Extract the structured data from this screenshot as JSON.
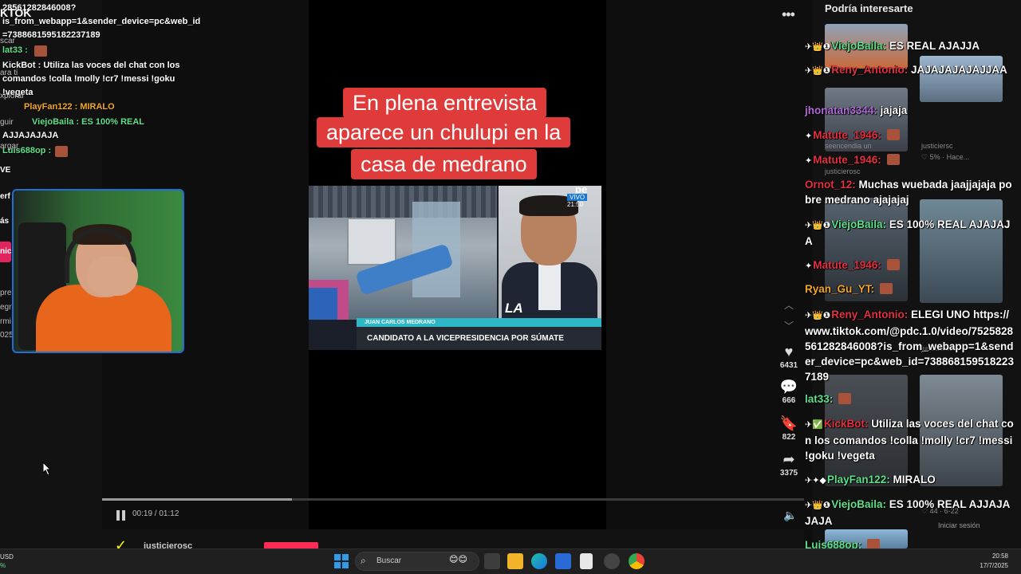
{
  "tiktok": {
    "caption_lines": [
      "En plena entrevista",
      "aparece un chulupi en la",
      "casa de medrano"
    ],
    "news": {
      "channel_logo": "pe",
      "live_label": "VIVO",
      "live_time": "21:50",
      "show_name": "LA CAFETERIA",
      "person_name": "JUAN CARLOS MEDRANO",
      "person_title": "CANDIDATO A LA VICEPRESIDENCIA POR SÚMATE"
    },
    "player": {
      "current_time": "00:19",
      "duration": "01:12",
      "time_display": "00:19 / 01:12",
      "progress_fraction": 0.27
    },
    "author": {
      "name": "justicierosc"
    },
    "actions": [
      {
        "name": "like",
        "icon": "heart-icon",
        "count": "6431"
      },
      {
        "name": "comment",
        "icon": "comment-icon",
        "count": "666"
      },
      {
        "name": "bookmark",
        "icon": "bookmark-icon",
        "count": "822"
      },
      {
        "name": "share",
        "icon": "share-icon",
        "count": "3375"
      }
    ],
    "suggest_title": "Podría interesarte",
    "suggest_meta": [
      "justiciersc",
      "♡ 5% · Hace...",
      "seencendia un",
      "justicierosc",
      "justicierosc",
      "♡ 44 · 6-22"
    ],
    "login_text": "Iniciar sesión"
  },
  "left_chat": {
    "lines": [
      "28561282846008?",
      "is_from_webapp=1&sender_device=pc&web_id",
      "=7388681595182237189",
      "lat33 :",
      "KickBot : Utiliza las voces del chat con los",
      "comandos !colla !molly !cr7 !messi !goku",
      "!vegeta",
      "PlayFan122 : MIRALO",
      "ViejoBaila : ES 100% REAL",
      "AJJAJAJAJA",
      "Luis688op :"
    ],
    "side_fragments": [
      "KTOK",
      "scar",
      "ara ti",
      "xplorar",
      "guir",
      "argar",
      "VE",
      "erf",
      "ás",
      "nic",
      "pre",
      "egr",
      "rmi",
      "025"
    ]
  },
  "right_chat": [
    {
      "user": "ViejoBaila",
      "color": "green",
      "badges": "✈👑❶",
      "text": "ES REAL AJAJJA"
    },
    {
      "user": "Reny_Antonio",
      "color": "red",
      "badges": "✈👑❶",
      "text": "JAJAJAJAJAJJAA"
    },
    {
      "user": "jhonatan3344",
      "color": "purple",
      "badges": "",
      "text": "jajaja"
    },
    {
      "user": "Matute_1946",
      "color": "red",
      "badges": "✦",
      "text": ""
    },
    {
      "user": "Matute_1946",
      "color": "red",
      "badges": "✦",
      "text": ""
    },
    {
      "user": "Ornot_12",
      "color": "red",
      "badges": "",
      "text": "Muchas wuebada jaajjajaja pobre medrano ajajajaj"
    },
    {
      "user": "ViejoBaila",
      "color": "green",
      "badges": "✈👑❶",
      "text": "ES 100% REAL AJAJAJA"
    },
    {
      "user": "Matute_1946",
      "color": "red",
      "badges": "✦",
      "text": ""
    },
    {
      "user": "Ryan_Gu_YT",
      "color": "orange",
      "badges": "",
      "text": ""
    },
    {
      "user": "Reny_Antonio",
      "color": "red",
      "badges": "✈👑❶",
      "text": "ELEGI UNO https://www.tiktok.com/@pdc.1.0/video/7525828561282846008?is_from_webapp=1&sender_device=pc&web_id=7388681595182237189"
    },
    {
      "user": "lat33",
      "color": "green",
      "badges": "",
      "text": ""
    },
    {
      "user": "KickBot",
      "color": "red",
      "badges": "✈✅",
      "text": "Utiliza las voces del chat con los comandos !colla !molly !cr7 !messi !goku !vegeta"
    },
    {
      "user": "PlayFan122",
      "color": "green",
      "badges": "✈✦◆",
      "text": "MIRALO"
    },
    {
      "user": "ViejoBaila",
      "color": "green",
      "badges": "✈👑❶",
      "text": "ES 100% REAL AJJAJAJAJA"
    },
    {
      "user": "Luis688op",
      "color": "green",
      "badges": "",
      "text": ""
    }
  ],
  "taskbar": {
    "weather_line1": "USD",
    "weather_line2": "%",
    "search_placeholder": "Buscar",
    "time": "20:58",
    "date": "17/7/2025"
  },
  "colors": {
    "caption_red": "#e03b3b",
    "tiktok_pink": "#fe2c55",
    "webcam_border": "#1f6fd6",
    "chat_green": "#5fe08a",
    "chat_red": "#e5303f"
  }
}
